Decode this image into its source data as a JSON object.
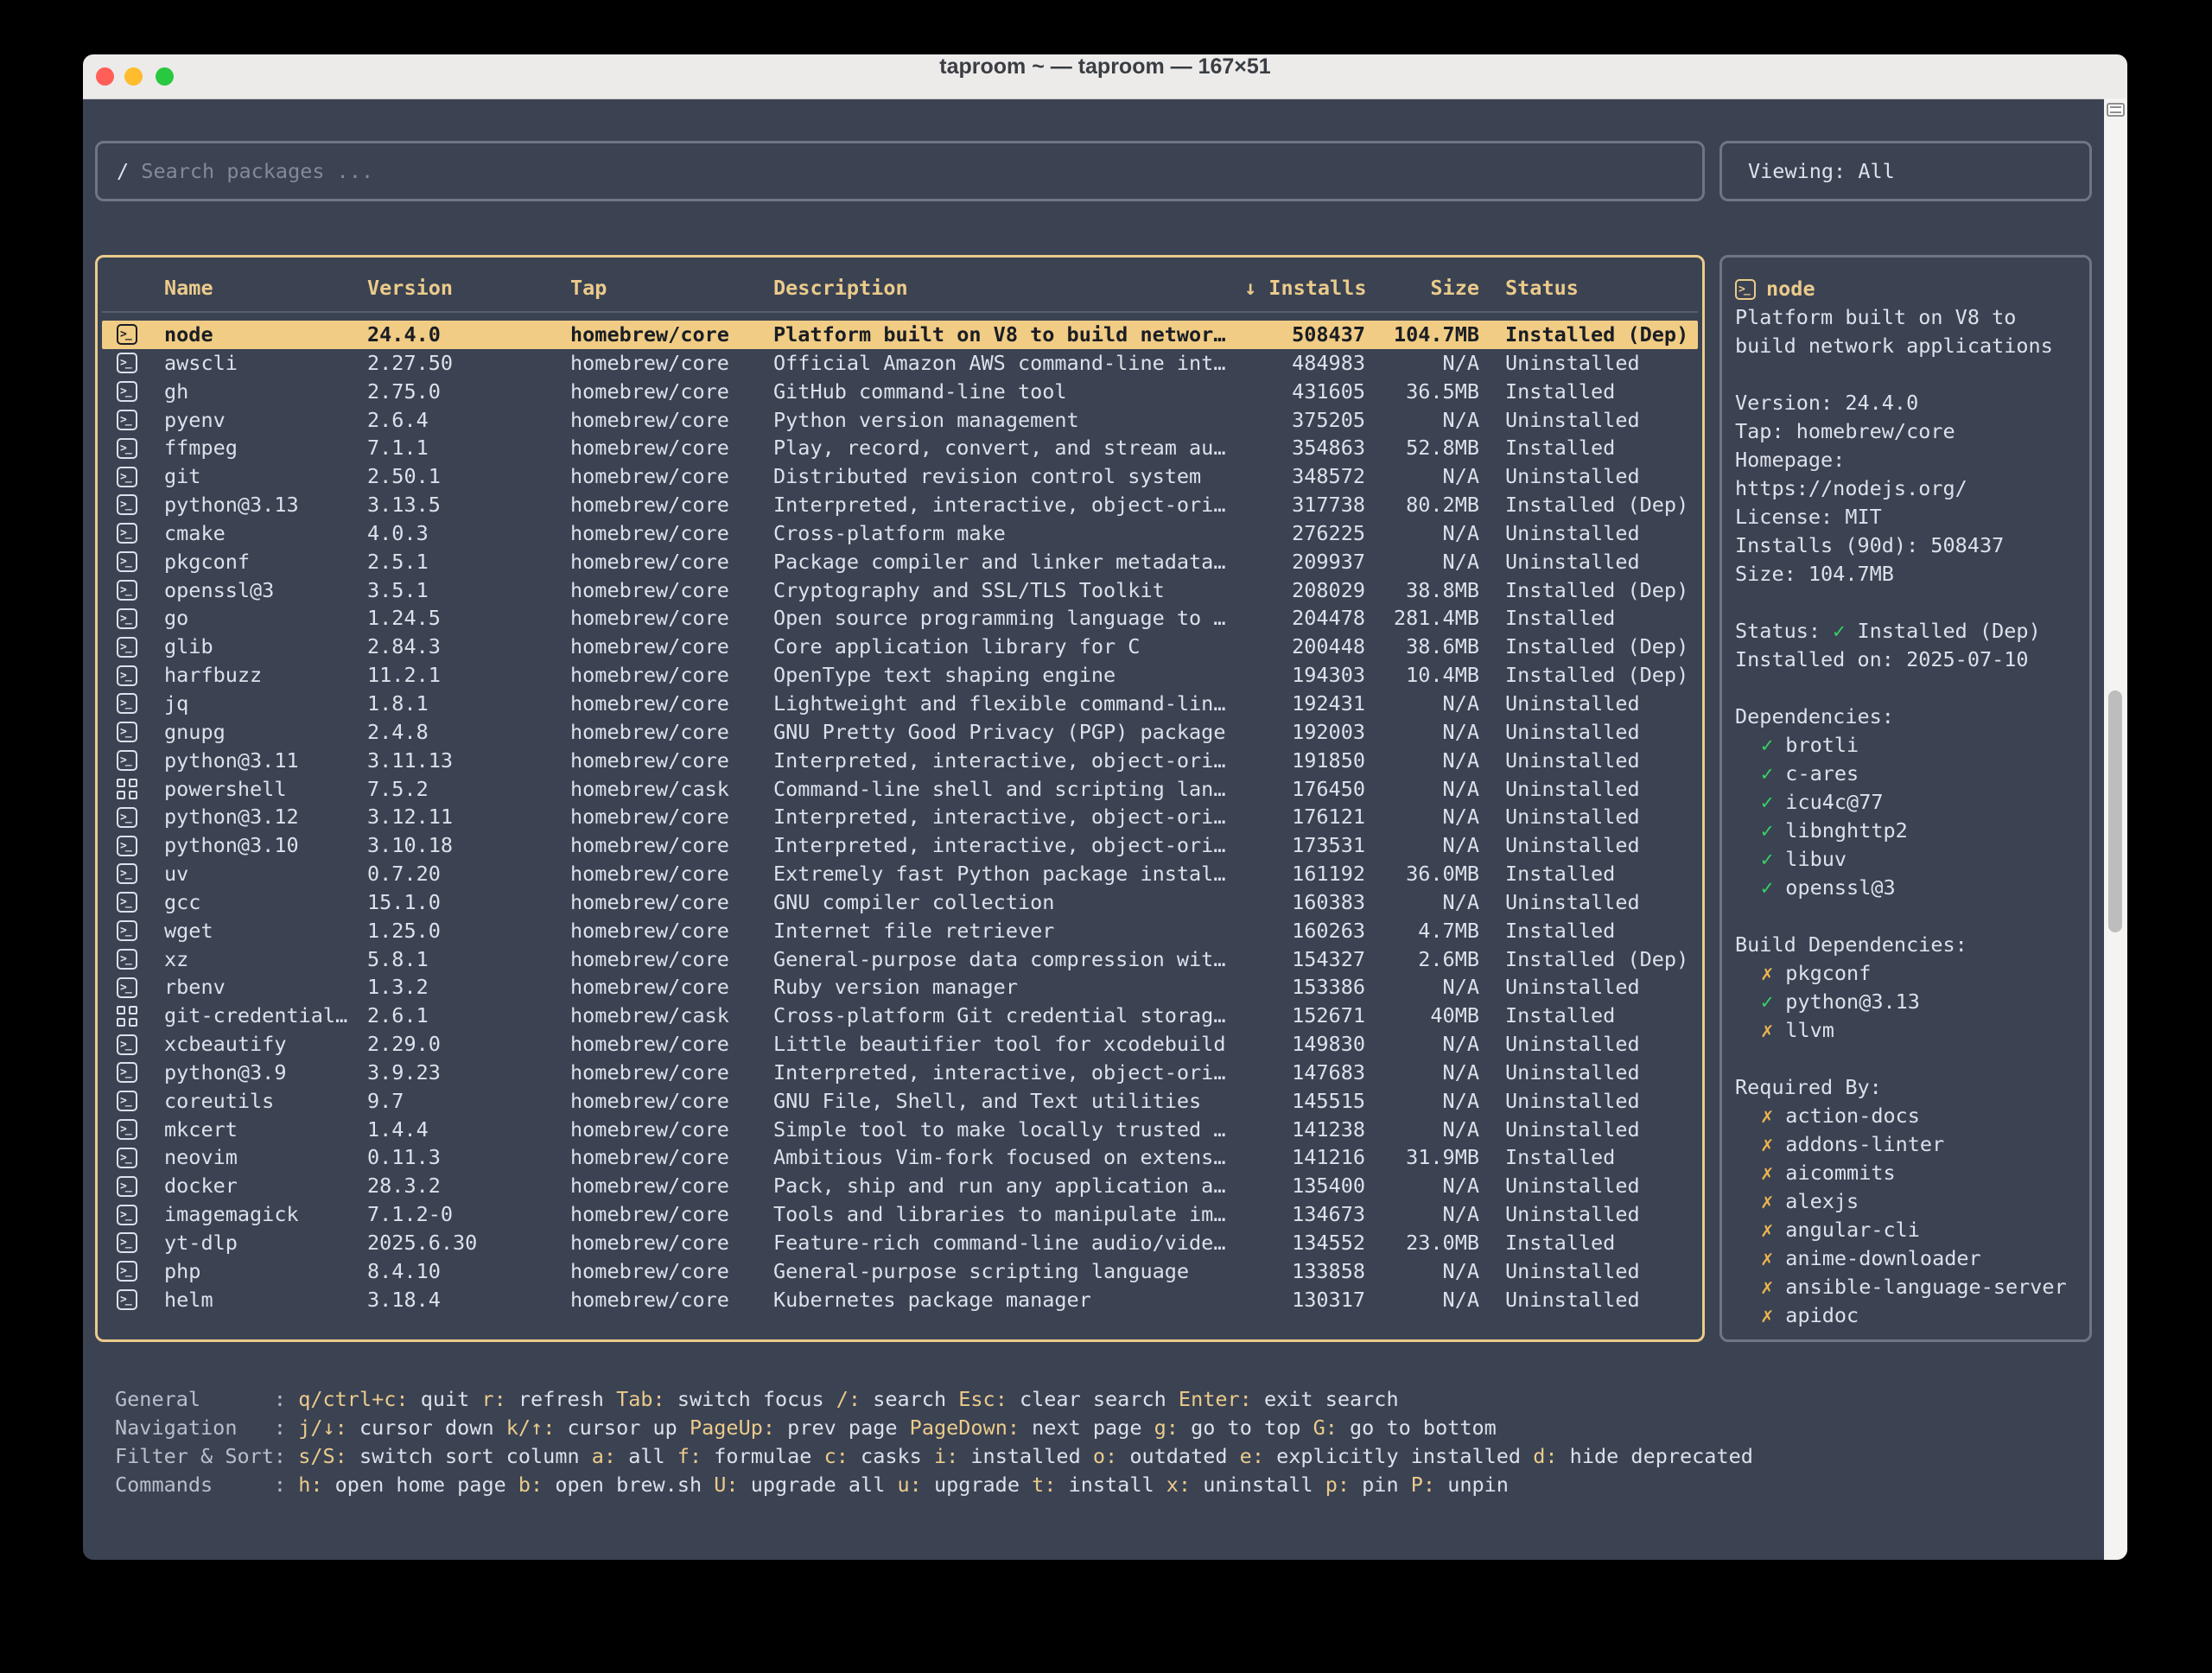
{
  "window": {
    "title": "taproom ~ — taproom — 167×51"
  },
  "glyphs": {
    "check": "✓",
    "cross": "✗",
    "sort_down": "↓"
  },
  "colors": {
    "background": "#3B4252",
    "accent_yellow": "#EBCB8B",
    "selected_row_bg": "#F0CC85",
    "text_light": "#DCE1EA",
    "check_green": "#37D264",
    "cross_yellow": "#EDB54F",
    "traffic_red": "#FF5F57",
    "traffic_yellow": "#FEBC2E",
    "traffic_green": "#28C840"
  },
  "search": {
    "prompt": "/",
    "placeholder": " Search packages ..."
  },
  "viewing": {
    "label": "Viewing: All"
  },
  "table": {
    "sort_glyph": "↓",
    "columns": [
      {
        "id": "name",
        "label": "Name"
      },
      {
        "id": "version",
        "label": "Version"
      },
      {
        "id": "tap",
        "label": "Tap"
      },
      {
        "id": "desc",
        "label": "Description"
      },
      {
        "id": "installs",
        "label": "Installs",
        "sorted": true
      },
      {
        "id": "size",
        "label": "Size"
      },
      {
        "id": "status",
        "label": "Status"
      }
    ],
    "rows": [
      {
        "icon": "formula",
        "name": "node",
        "version": "24.4.0",
        "tap": "homebrew/core",
        "description": "Platform built on V8 to build networ…",
        "installs": "508437",
        "size": "104.7MB",
        "status": "Installed (Dep)",
        "selected": true
      },
      {
        "icon": "formula",
        "name": "awscli",
        "version": "2.27.50",
        "tap": "homebrew/core",
        "description": "Official Amazon AWS command-line int…",
        "installs": "484983",
        "size": "N/A",
        "status": "Uninstalled"
      },
      {
        "icon": "formula",
        "name": "gh",
        "version": "2.75.0",
        "tap": "homebrew/core",
        "description": "GitHub command-line tool",
        "installs": "431605",
        "size": "36.5MB",
        "status": "Installed"
      },
      {
        "icon": "formula",
        "name": "pyenv",
        "version": "2.6.4",
        "tap": "homebrew/core",
        "description": "Python version management",
        "installs": "375205",
        "size": "N/A",
        "status": "Uninstalled"
      },
      {
        "icon": "formula",
        "name": "ffmpeg",
        "version": "7.1.1",
        "tap": "homebrew/core",
        "description": "Play, record, convert, and stream au…",
        "installs": "354863",
        "size": "52.8MB",
        "status": "Installed"
      },
      {
        "icon": "formula",
        "name": "git",
        "version": "2.50.1",
        "tap": "homebrew/core",
        "description": "Distributed revision control system",
        "installs": "348572",
        "size": "N/A",
        "status": "Uninstalled"
      },
      {
        "icon": "formula",
        "name": "python@3.13",
        "version": "3.13.5",
        "tap": "homebrew/core",
        "description": "Interpreted, interactive, object-ori…",
        "installs": "317738",
        "size": "80.2MB",
        "status": "Installed (Dep)"
      },
      {
        "icon": "formula",
        "name": "cmake",
        "version": "4.0.3",
        "tap": "homebrew/core",
        "description": "Cross-platform make",
        "installs": "276225",
        "size": "N/A",
        "status": "Uninstalled"
      },
      {
        "icon": "formula",
        "name": "pkgconf",
        "version": "2.5.1",
        "tap": "homebrew/core",
        "description": "Package compiler and linker metadata…",
        "installs": "209937",
        "size": "N/A",
        "status": "Uninstalled"
      },
      {
        "icon": "formula",
        "name": "openssl@3",
        "version": "3.5.1",
        "tap": "homebrew/core",
        "description": "Cryptography and SSL/TLS Toolkit",
        "installs": "208029",
        "size": "38.8MB",
        "status": "Installed (Dep)"
      },
      {
        "icon": "formula",
        "name": "go",
        "version": "1.24.5",
        "tap": "homebrew/core",
        "description": "Open source programming language to …",
        "installs": "204478",
        "size": "281.4MB",
        "status": "Installed"
      },
      {
        "icon": "formula",
        "name": "glib",
        "version": "2.84.3",
        "tap": "homebrew/core",
        "description": "Core application library for C",
        "installs": "200448",
        "size": "38.6MB",
        "status": "Installed (Dep)"
      },
      {
        "icon": "formula",
        "name": "harfbuzz",
        "version": "11.2.1",
        "tap": "homebrew/core",
        "description": "OpenType text shaping engine",
        "installs": "194303",
        "size": "10.4MB",
        "status": "Installed (Dep)"
      },
      {
        "icon": "formula",
        "name": "jq",
        "version": "1.8.1",
        "tap": "homebrew/core",
        "description": "Lightweight and flexible command-lin…",
        "installs": "192431",
        "size": "N/A",
        "status": "Uninstalled"
      },
      {
        "icon": "formula",
        "name": "gnupg",
        "version": "2.4.8",
        "tap": "homebrew/core",
        "description": "GNU Pretty Good Privacy (PGP) package",
        "installs": "192003",
        "size": "N/A",
        "status": "Uninstalled"
      },
      {
        "icon": "formula",
        "name": "python@3.11",
        "version": "3.11.13",
        "tap": "homebrew/core",
        "description": "Interpreted, interactive, object-ori…",
        "installs": "191850",
        "size": "N/A",
        "status": "Uninstalled"
      },
      {
        "icon": "cask",
        "name": "powershell",
        "version": "7.5.2",
        "tap": "homebrew/cask",
        "description": "Command-line shell and scripting lan…",
        "installs": "176450",
        "size": "N/A",
        "status": "Uninstalled"
      },
      {
        "icon": "formula",
        "name": "python@3.12",
        "version": "3.12.11",
        "tap": "homebrew/core",
        "description": "Interpreted, interactive, object-ori…",
        "installs": "176121",
        "size": "N/A",
        "status": "Uninstalled"
      },
      {
        "icon": "formula",
        "name": "python@3.10",
        "version": "3.10.18",
        "tap": "homebrew/core",
        "description": "Interpreted, interactive, object-ori…",
        "installs": "173531",
        "size": "N/A",
        "status": "Uninstalled"
      },
      {
        "icon": "formula",
        "name": "uv",
        "version": "0.7.20",
        "tap": "homebrew/core",
        "description": "Extremely fast Python package instal…",
        "installs": "161192",
        "size": "36.0MB",
        "status": "Installed"
      },
      {
        "icon": "formula",
        "name": "gcc",
        "version": "15.1.0",
        "tap": "homebrew/core",
        "description": "GNU compiler collection",
        "installs": "160383",
        "size": "N/A",
        "status": "Uninstalled"
      },
      {
        "icon": "formula",
        "name": "wget",
        "version": "1.25.0",
        "tap": "homebrew/core",
        "description": "Internet file retriever",
        "installs": "160263",
        "size": "4.7MB",
        "status": "Installed"
      },
      {
        "icon": "formula",
        "name": "xz",
        "version": "5.8.1",
        "tap": "homebrew/core",
        "description": "General-purpose data compression wit…",
        "installs": "154327",
        "size": "2.6MB",
        "status": "Installed (Dep)"
      },
      {
        "icon": "formula",
        "name": "rbenv",
        "version": "1.3.2",
        "tap": "homebrew/core",
        "description": "Ruby version manager",
        "installs": "153386",
        "size": "N/A",
        "status": "Uninstalled"
      },
      {
        "icon": "cask",
        "name": "git-credential…",
        "version": "2.6.1",
        "tap": "homebrew/cask",
        "description": "Cross-platform Git credential storag…",
        "installs": "152671",
        "size": "40MB",
        "status": "Installed"
      },
      {
        "icon": "formula",
        "name": "xcbeautify",
        "version": "2.29.0",
        "tap": "homebrew/core",
        "description": "Little beautifier tool for xcodebuild",
        "installs": "149830",
        "size": "N/A",
        "status": "Uninstalled"
      },
      {
        "icon": "formula",
        "name": "python@3.9",
        "version": "3.9.23",
        "tap": "homebrew/core",
        "description": "Interpreted, interactive, object-ori…",
        "installs": "147683",
        "size": "N/A",
        "status": "Uninstalled"
      },
      {
        "icon": "formula",
        "name": "coreutils",
        "version": "9.7",
        "tap": "homebrew/core",
        "description": "GNU File, Shell, and Text utilities",
        "installs": "145515",
        "size": "N/A",
        "status": "Uninstalled"
      },
      {
        "icon": "formula",
        "name": "mkcert",
        "version": "1.4.4",
        "tap": "homebrew/core",
        "description": "Simple tool to make locally trusted …",
        "installs": "141238",
        "size": "N/A",
        "status": "Uninstalled"
      },
      {
        "icon": "formula",
        "name": "neovim",
        "version": "0.11.3",
        "tap": "homebrew/core",
        "description": "Ambitious Vim-fork focused on extens…",
        "installs": "141216",
        "size": "31.9MB",
        "status": "Installed"
      },
      {
        "icon": "formula",
        "name": "docker",
        "version": "28.3.2",
        "tap": "homebrew/core",
        "description": "Pack, ship and run any application a…",
        "installs": "135400",
        "size": "N/A",
        "status": "Uninstalled"
      },
      {
        "icon": "formula",
        "name": "imagemagick",
        "version": "7.1.2-0",
        "tap": "homebrew/core",
        "description": "Tools and libraries to manipulate im…",
        "installs": "134673",
        "size": "N/A",
        "status": "Uninstalled"
      },
      {
        "icon": "formula",
        "name": "yt-dlp",
        "version": "2025.6.30",
        "tap": "homebrew/core",
        "description": "Feature-rich command-line audio/vide…",
        "installs": "134552",
        "size": "23.0MB",
        "status": "Installed"
      },
      {
        "icon": "formula",
        "name": "php",
        "version": "8.4.10",
        "tap": "homebrew/core",
        "description": "General-purpose scripting language",
        "installs": "133858",
        "size": "N/A",
        "status": "Uninstalled"
      },
      {
        "icon": "formula",
        "name": "helm",
        "version": "3.18.4",
        "tap": "homebrew/core",
        "description": "Kubernetes package manager",
        "installs": "130317",
        "size": "N/A",
        "status": "Uninstalled"
      }
    ]
  },
  "detail": {
    "name": "node",
    "description_lines": [
      "Platform built on V8 to",
      "build network applications"
    ],
    "fields": [
      "Version: 24.4.0",
      "Tap: homebrew/core",
      "Homepage:",
      "https://nodejs.org/",
      "License: MIT",
      "Installs (90d): 508437",
      "Size: 104.7MB"
    ],
    "status_prefix": "Status: ",
    "status_text": " Installed (Dep)",
    "installed_on": "Installed on: 2025-07-10",
    "sections": [
      {
        "title": "Dependencies:",
        "items": [
          {
            "mark": "check",
            "name": "brotli"
          },
          {
            "mark": "check",
            "name": "c-ares"
          },
          {
            "mark": "check",
            "name": "icu4c@77"
          },
          {
            "mark": "check",
            "name": "libnghttp2"
          },
          {
            "mark": "check",
            "name": "libuv"
          },
          {
            "mark": "check",
            "name": "openssl@3"
          }
        ]
      },
      {
        "title": "Build Dependencies:",
        "items": [
          {
            "mark": "cross",
            "name": "pkgconf"
          },
          {
            "mark": "check",
            "name": "python@3.13"
          },
          {
            "mark": "cross",
            "name": "llvm"
          }
        ]
      },
      {
        "title": "Required By:",
        "items": [
          {
            "mark": "cross",
            "name": "action-docs"
          },
          {
            "mark": "cross",
            "name": "addons-linter"
          },
          {
            "mark": "cross",
            "name": "aicommits"
          },
          {
            "mark": "cross",
            "name": "alexjs"
          },
          {
            "mark": "cross",
            "name": "angular-cli"
          },
          {
            "mark": "cross",
            "name": "anime-downloader"
          },
          {
            "mark": "cross",
            "name": "ansible-language-server"
          },
          {
            "mark": "cross",
            "name": "apidoc"
          }
        ]
      }
    ]
  },
  "help": {
    "lines": [
      {
        "label": "General",
        "items": [
          {
            "key": "q/ctrl+c",
            "desc": "quit"
          },
          {
            "key": "r",
            "desc": "refresh"
          },
          {
            "key": "Tab",
            "desc": "switch focus"
          },
          {
            "key": "/",
            "desc": "search"
          },
          {
            "key": "Esc",
            "desc": "clear search"
          },
          {
            "key": "Enter",
            "desc": "exit search"
          }
        ]
      },
      {
        "label": "Navigation",
        "items": [
          {
            "key": "j/↓",
            "desc": "cursor down"
          },
          {
            "key": "k/↑",
            "desc": "cursor up"
          },
          {
            "key": "PageUp",
            "desc": "prev page"
          },
          {
            "key": "PageDown",
            "desc": "next page"
          },
          {
            "key": "g",
            "desc": "go to top"
          },
          {
            "key": "G",
            "desc": "go to bottom"
          }
        ]
      },
      {
        "label": "Filter & Sort",
        "items": [
          {
            "key": "s/S",
            "desc": "switch sort column"
          },
          {
            "key": "a",
            "desc": "all"
          },
          {
            "key": "f",
            "desc": "formulae"
          },
          {
            "key": "c",
            "desc": "casks"
          },
          {
            "key": "i",
            "desc": "installed"
          },
          {
            "key": "o",
            "desc": "outdated"
          },
          {
            "key": "e",
            "desc": "explicitly installed"
          },
          {
            "key": "d",
            "desc": "hide deprecated"
          }
        ]
      },
      {
        "label": "Commands",
        "items": [
          {
            "key": "h",
            "desc": "open home page"
          },
          {
            "key": "b",
            "desc": "open brew.sh"
          },
          {
            "key": "U",
            "desc": "upgrade all"
          },
          {
            "key": "u",
            "desc": "upgrade"
          },
          {
            "key": "t",
            "desc": "install"
          },
          {
            "key": "x",
            "desc": "uninstall"
          },
          {
            "key": "p",
            "desc": "pin"
          },
          {
            "key": "P",
            "desc": "unpin"
          }
        ]
      }
    ]
  }
}
